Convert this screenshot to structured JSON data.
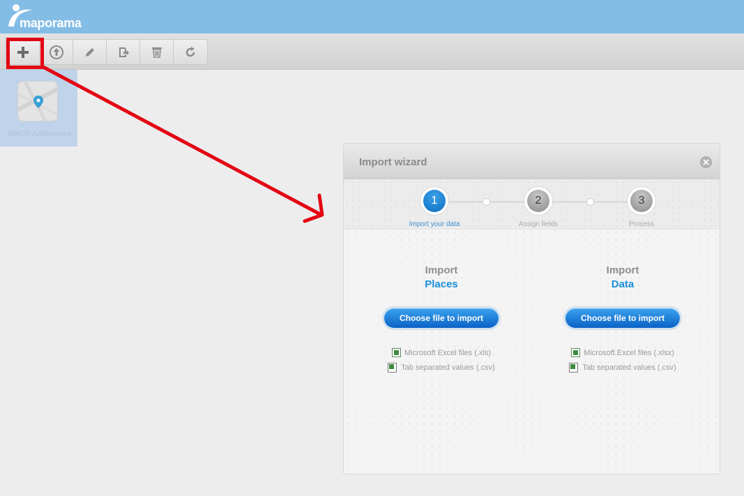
{
  "app": {
    "brand": "maporama"
  },
  "toolbar": {
    "buttons": [
      {
        "name": "add-icon"
      },
      {
        "name": "upload-icon"
      },
      {
        "name": "pencil-icon"
      },
      {
        "name": "export-icon"
      },
      {
        "name": "trash-icon"
      },
      {
        "name": "refresh-icon"
      }
    ]
  },
  "sidebar": {
    "place_label": "TIBCO Addresses"
  },
  "wizard": {
    "title": "Import wizard",
    "steps": [
      {
        "number": "1",
        "label": "Import your data",
        "active": true
      },
      {
        "number": "2",
        "label": "Assign fields",
        "active": false
      },
      {
        "number": "3",
        "label": "Process",
        "active": false
      }
    ],
    "places": {
      "pre": "Import",
      "main": "Places",
      "button": "Choose file to import",
      "filetypes": [
        "Microsoft Excel files (.xls)",
        "Tab separated values (.csv)"
      ]
    },
    "data": {
      "pre": "Import",
      "main": "Data",
      "button": "Choose file to import",
      "filetypes": [
        "Microsoft Excel files (.xlsx)",
        "Tab separated values (.csv)"
      ]
    }
  },
  "colors": {
    "header": "#83bde6",
    "accent": "#1a8fd8",
    "annotation": "#e30613"
  }
}
